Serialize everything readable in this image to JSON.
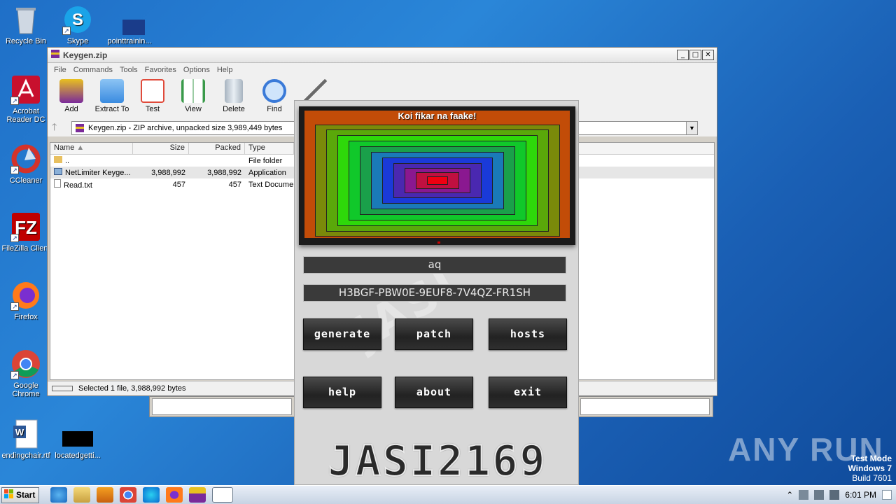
{
  "desktop": {
    "icons": [
      {
        "label": "Recycle Bin"
      },
      {
        "label": "Skype"
      },
      {
        "label": "pointtrainin..."
      },
      {
        "label": "Acrobat Reader DC"
      },
      {
        "label": "CCleaner"
      },
      {
        "label": "FileZilla Client"
      },
      {
        "label": "Firefox"
      },
      {
        "label": "Google Chrome"
      },
      {
        "label": "endingchair.rtf"
      },
      {
        "label": "locatedgetti..."
      }
    ]
  },
  "winrar": {
    "title": "Keygen.zip",
    "menu": [
      "File",
      "Commands",
      "Tools",
      "Favorites",
      "Options",
      "Help"
    ],
    "tools": [
      {
        "label": "Add",
        "color": "#d23a2a"
      },
      {
        "label": "Extract To",
        "color": "#3a8be0"
      },
      {
        "label": "Test",
        "color": "#e04a3a"
      },
      {
        "label": "View",
        "color": "#3a9a4a"
      },
      {
        "label": "Delete",
        "color": "#8a9aa8"
      },
      {
        "label": "Find",
        "color": "#3a7ad8"
      }
    ],
    "address": "Keygen.zip - ZIP archive, unpacked size 3,989,449 bytes",
    "columns": [
      "Name",
      "Size",
      "Packed",
      "Type"
    ],
    "rows": [
      {
        "name": "..",
        "size": "",
        "packed": "",
        "type": "File folder"
      },
      {
        "name": "NetLimiter Keyge...",
        "size": "3,988,992",
        "packed": "3,988,992",
        "type": "Application"
      },
      {
        "name": "Read.txt",
        "size": "457",
        "packed": "457",
        "type": "Text Docume"
      }
    ],
    "status": "Selected 1 file, 3,988,992 bytes"
  },
  "keygen": {
    "banner": "Koi fikar na faake!",
    "name_value": "aq",
    "serial_value": "H3BGF-PBW0E-9EUF8-7V4QZ-FR1SH",
    "buttons": {
      "generate": "Generate",
      "patch": "Patch",
      "hosts": "Hosts",
      "help": "Help",
      "about": "About",
      "exit": "Exit"
    },
    "brand": "JASI2169"
  },
  "watermark": {
    "text": "ANY RUN"
  },
  "testmode": {
    "line1": "Test Mode",
    "line2": "Windows 7",
    "line3": "Build 7601"
  },
  "taskbar": {
    "start_label": "Start",
    "clock": "6:01 PM"
  }
}
